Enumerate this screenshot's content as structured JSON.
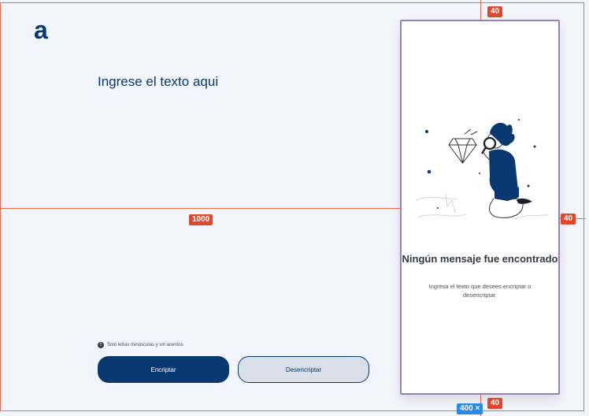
{
  "app": {
    "logo": "a"
  },
  "main": {
    "heading": "Ingrese el texto aqui"
  },
  "note": {
    "icon": "info-icon",
    "text": "Solo letras minúsculas y sin acentos"
  },
  "actions": {
    "encrypt": "Encriptar",
    "decrypt": "Desencriptar"
  },
  "panel": {
    "title": "Ningún mensaje fue encontrado",
    "description": "Ingresa el texto que desees encriptar o desencriptar."
  },
  "measurements": {
    "left_width": "1000",
    "top_spacing": "40",
    "right_spacing": "40",
    "bottom_spacing": "40",
    "panel_size": "400 ×"
  },
  "colors": {
    "primary": "#0a3871",
    "guide": "#e2472b",
    "accent_blue": "#2a88e8"
  }
}
